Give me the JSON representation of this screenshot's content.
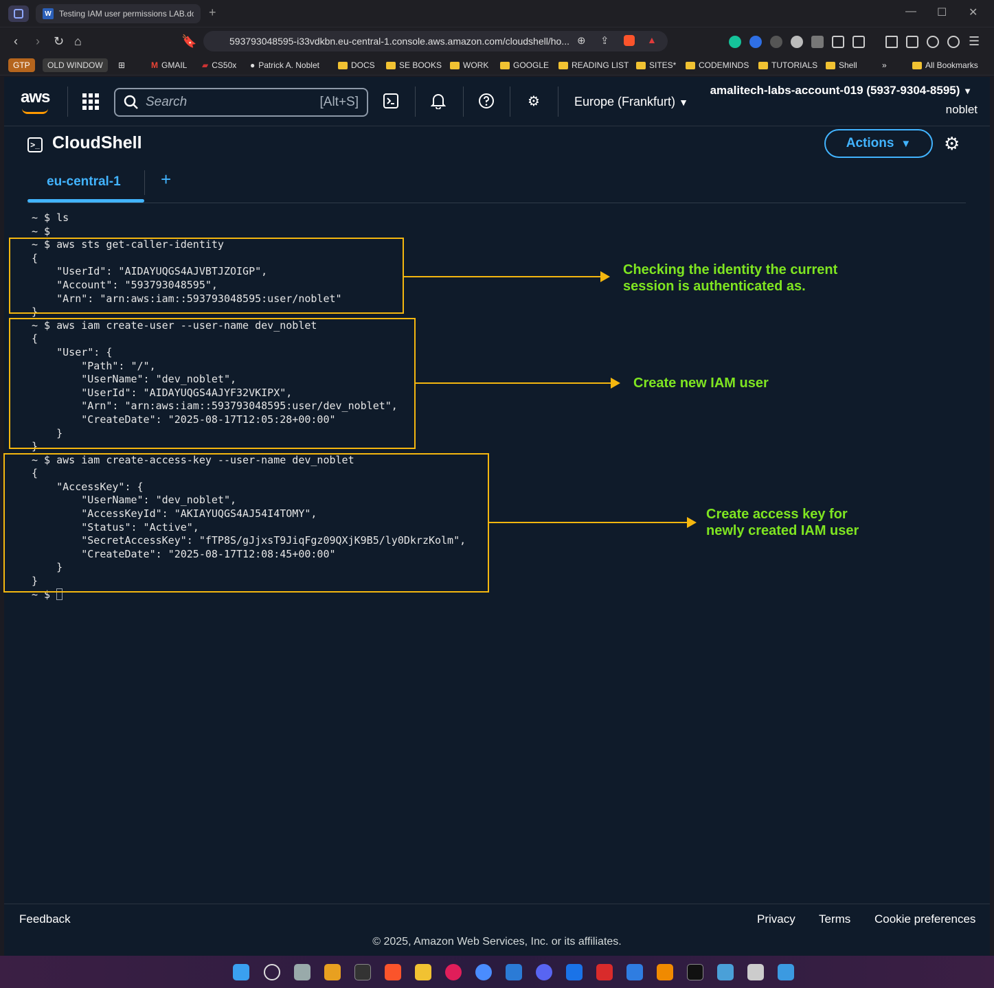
{
  "browser": {
    "tab_title": "Testing IAM user permissions LAB.do",
    "url": "593793048595-i33vdkbn.eu-central-1.console.aws.amazon.com/cloudshell/ho...",
    "bookmarks": [
      "GTP",
      "OLD WINDOW",
      "GMAIL",
      "CS50x",
      "Patrick A. Noblet",
      "DOCS",
      "SE BOOKS",
      "WORK",
      "GOOGLE",
      "READING LIST",
      "SITES*",
      "CODEMINDS",
      "TUTORIALS",
      "Shell",
      "All Bookmarks"
    ]
  },
  "aws_header": {
    "logo": "aws",
    "search_placeholder": "Search",
    "search_shortcut": "[Alt+S]",
    "region": "Europe (Frankfurt)",
    "account": "amalitech-labs-account-019 (5937-9304-8595)",
    "user": "noblet"
  },
  "cloudshell": {
    "title": "CloudShell",
    "actions_label": "Actions",
    "region_tab": "eu-central-1",
    "terminal_lines": [
      "~ $ ls",
      "~ $",
      "~ $ aws sts get-caller-identity",
      "{",
      "    \"UserId\": \"AIDAYUQGS4AJVBTJZOIGP\",",
      "    \"Account\": \"593793048595\",",
      "    \"Arn\": \"arn:aws:iam::593793048595:user/noblet\"",
      "}",
      "~ $ aws iam create-user --user-name dev_noblet",
      "{",
      "    \"User\": {",
      "        \"Path\": \"/\",",
      "        \"UserName\": \"dev_noblet\",",
      "        \"UserId\": \"AIDAYUQGS4AJYF32VKIPX\",",
      "        \"Arn\": \"arn:aws:iam::593793048595:user/dev_noblet\",",
      "        \"CreateDate\": \"2025-08-17T12:05:28+00:00\"",
      "    }",
      "}",
      "~ $ aws iam create-access-key --user-name dev_noblet",
      "{",
      "    \"AccessKey\": {",
      "        \"UserName\": \"dev_noblet\",",
      "        \"AccessKeyId\": \"AKIAYUQGS4AJ54I4TOMY\",",
      "        \"Status\": \"Active\",",
      "        \"SecretAccessKey\": \"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\",",
      "        \"CreateDate\": \"2025-08-17T12:08:45+00:00\"",
      "    }",
      "}"
    ],
    "prompt": "~ $ "
  },
  "annotations": {
    "note1": "Checking the identity the current\nsession is authenticated as.",
    "note2": "Create new IAM user",
    "note3": "Create access key for\nnewly created IAM user",
    "box_color": "#f5b70f",
    "note_color": "#7fe521"
  },
  "footer": {
    "feedback": "Feedback",
    "privacy": "Privacy",
    "terms": "Terms",
    "cookies": "Cookie preferences",
    "copyright": "© 2025, Amazon Web Services, Inc. or its affiliates."
  }
}
